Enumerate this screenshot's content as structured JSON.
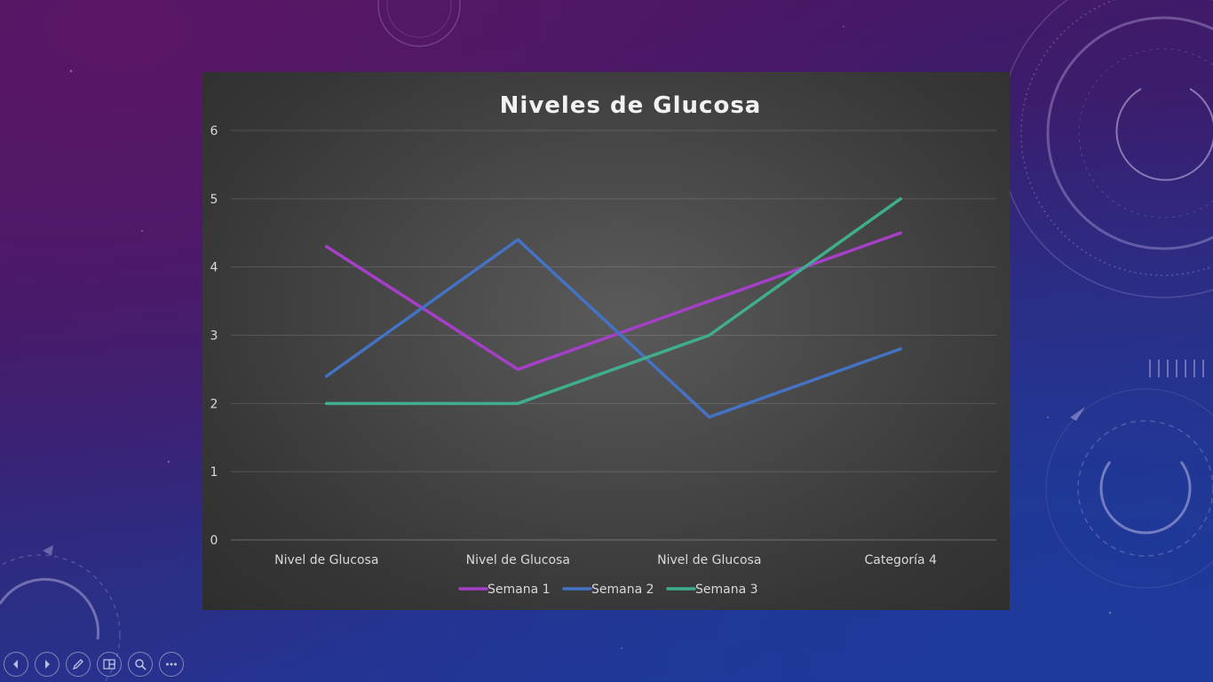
{
  "chart_data": {
    "type": "line",
    "title": "Niveles de Glucosa",
    "categories": [
      "Nivel de Glucosa",
      "Nivel de Glucosa",
      "Nivel de Glucosa",
      "Categoría 4"
    ],
    "series": [
      {
        "name": "Semana 1",
        "values": [
          4.3,
          2.5,
          3.5,
          4.5
        ],
        "color": "#a63fc8"
      },
      {
        "name": "Semana 2",
        "values": [
          2.4,
          4.4,
          1.8,
          2.8
        ],
        "color": "#4472c4"
      },
      {
        "name": "Semana 3",
        "values": [
          2.0,
          2.0,
          3.0,
          5.0
        ],
        "color": "#3fae8e"
      }
    ],
    "ylim": [
      0,
      6
    ],
    "yticks": [
      "0",
      "1",
      "2",
      "3",
      "4",
      "5",
      "6"
    ],
    "grid": true,
    "legend_position": "bottom"
  },
  "toolbar": {
    "buttons": [
      {
        "name": "previous-slide-button",
        "icon": "arrow-left-icon"
      },
      {
        "name": "next-slide-button",
        "icon": "arrow-right-icon"
      },
      {
        "name": "pen-tool-button",
        "icon": "pen-icon"
      },
      {
        "name": "see-all-slides-button",
        "icon": "slides-grid-icon"
      },
      {
        "name": "zoom-button",
        "icon": "magnifier-icon"
      },
      {
        "name": "more-options-button",
        "icon": "ellipsis-icon"
      }
    ]
  }
}
